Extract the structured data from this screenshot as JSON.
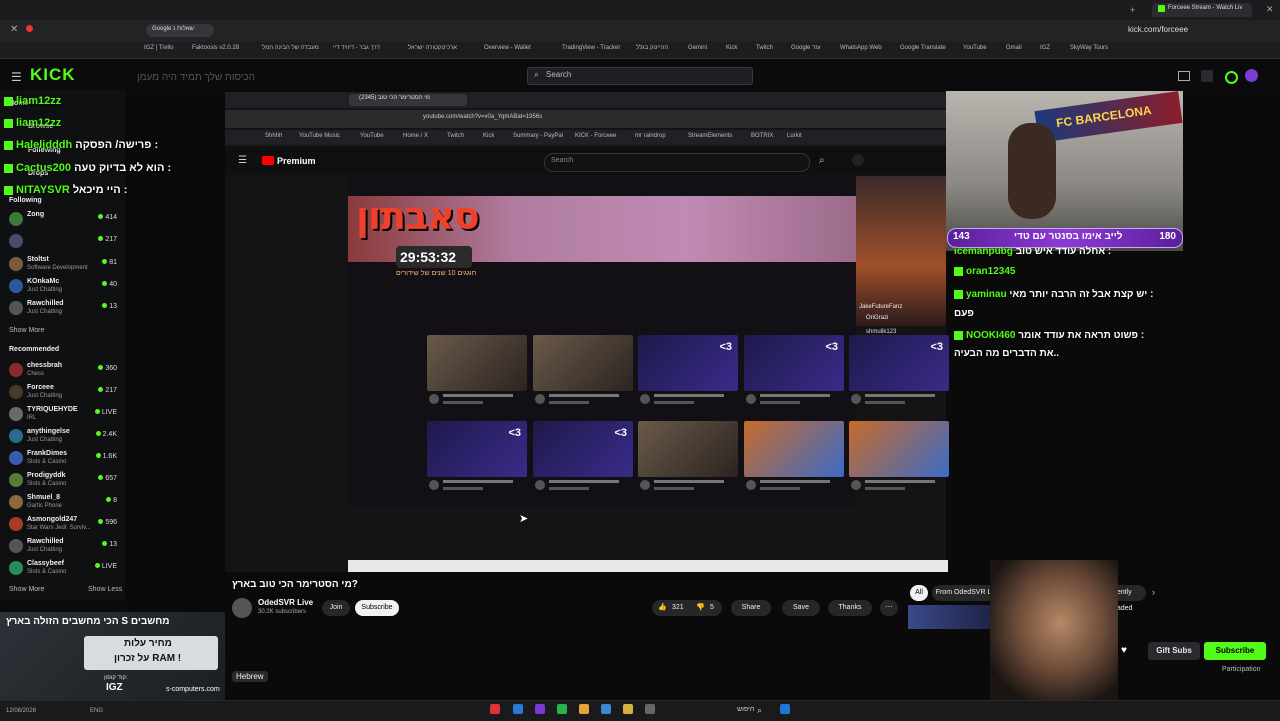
{
  "browser": {
    "tab_title": "Forceee Stream - Watch Liv",
    "url": "kick.com/forceee",
    "inner_tab_title": "Google שאלות נ",
    "bookmarks": [
      "IGZ | Trello",
      "Faktoosis v2.0.28",
      "מעבדה של הבינה המל",
      "דרך גבר - דיוויד דיי",
      "ארכיטקטורה ישראל",
      "Overview - Wallet",
      "TradingView - Tracker",
      "ההייטק בגלל",
      "Gemini",
      "Kick",
      "Twitch",
      "Google עזר",
      "WhatsApp Web",
      "Google Translate",
      "YouTube",
      "Gmail",
      "IGZ",
      "SkyWay Tours"
    ]
  },
  "kick": {
    "logo": "KICK",
    "search_placeholder": "Search",
    "faded_ticker": "הכיסות שלך תמיד היה מעמן",
    "nav": [
      "Home",
      "Browse",
      "Following",
      "Drops"
    ],
    "following_label": "Following",
    "following": [
      {
        "name": "Zong",
        "category": "",
        "count": "414"
      },
      {
        "name": "",
        "category": "",
        "count": "217"
      },
      {
        "name": "Stoltst",
        "category": "Software Development",
        "count": "81"
      },
      {
        "name": "KOnkaMc",
        "category": "Just Chatting",
        "count": "40"
      },
      {
        "name": "Rawchilled",
        "category": "Just Chatting",
        "count": "13"
      }
    ],
    "show_more": "Show More",
    "recommended_label": "Recommended",
    "recommended": [
      {
        "name": "chessbrah",
        "category": "Chess",
        "count": "360"
      },
      {
        "name": "Forceee",
        "category": "Just Chatting",
        "count": "217"
      },
      {
        "name": "TYRIQUEHYDE",
        "category": "IRL",
        "count": "LIVE"
      },
      {
        "name": "anythingelse",
        "category": "Just Chatting",
        "count": "2.4K"
      },
      {
        "name": "FrankDimes",
        "category": "Slots & Casino",
        "count": "1.6K"
      },
      {
        "name": "Prodigyddk",
        "category": "Slots & Casino",
        "count": "657"
      },
      {
        "name": "Shmuel_8",
        "category": "Gartic Phone",
        "count": "8"
      },
      {
        "name": "Asmongold247",
        "category": "Star Wars Jedi: Surviv...",
        "count": "596"
      },
      {
        "name": "Rawchilled",
        "category": "Just Chatting",
        "count": "13"
      },
      {
        "name": "Classybeef",
        "category": "Slots & Casino",
        "count": "LIVE"
      }
    ],
    "show_more_2": "Show More",
    "show_less": "Show Less",
    "gift_subs": "Gift Subs",
    "subscribe": "Subscribe",
    "participation": "Participation"
  },
  "overlay_chat_left": [
    {
      "user": "liam12zz",
      "message": ""
    },
    {
      "user": "liam12zz",
      "message": ""
    },
    {
      "user": "Haleljdddh",
      "message": "פרישה/ הפסקה :"
    },
    {
      "user": "Cactus200",
      "message": "הוא לא בדיוק טעה :"
    },
    {
      "user": "NITAYSVR",
      "message": "היי מיכאל :"
    }
  ],
  "overlay_chat_right": [
    {
      "user": "icemanpubg",
      "message": "אחלה עודד איש טוב :"
    },
    {
      "user": "oran12345",
      "message": ""
    },
    {
      "user": "yaminau",
      "message": "יש קצת אבל זה הרבה יותר מאי :"
    },
    {
      "user": "",
      "message": "פעם"
    },
    {
      "user": "NOOKI460",
      "message": "פשוט תראה את עודד אומר :"
    },
    {
      "user": "",
      "message": "את הדברים מה הבעיה.."
    }
  ],
  "webcam": {
    "flag_text": "FC BARCELONA",
    "bar_left": "143",
    "bar_text": "לייב אימו בסנטר עם טדי",
    "bar_right": "180"
  },
  "youtube": {
    "url": "youtube.com/watch?v=v0a_YqmABat=1956s",
    "tab": "מי הסטרימר הכי טוב (2345)",
    "bookmarks": [
      "Shhhh",
      "YouTube Music",
      "YouTube",
      "Home / X",
      "Twitch",
      "Kick",
      "Summary - PayPal",
      "KICK - Forceee",
      "mr raindrop",
      "StreamElements",
      "BOTRIX",
      "Lurkit"
    ],
    "logo": "Premium",
    "search_placeholder": "Search",
    "inner_banner_title": "סאבתון",
    "timer": "29:53:32",
    "timer_sub": "חוגגים 10 שנים של שידורים",
    "video_title": "מי הסטרימר הכי טוב בארץ?",
    "channel": "OdedSVR Live",
    "subs": "30.2K subscribers",
    "join": "Join",
    "subscribe": "Subscribe",
    "likes": "321",
    "dislikes": "5",
    "share": "Share",
    "save": "Save",
    "thanks": "Thanks",
    "chips": [
      "All",
      "From OdedSVR Live",
      "Recently uploaded"
    ],
    "language": "Hebrew",
    "inner_stream_overlay": [
      "JakeFutureFanz",
      "OriGrazi",
      "shmulik123"
    ]
  },
  "ad": {
    "line1": "הכי מחשבים הזולה בארץ S מחשבים",
    "price1": "מחיר עלות",
    "price2": "על זכרון RAM !",
    "code_label": "קוד קופון:",
    "code": "IGZ",
    "site": "s-computers.com"
  },
  "taskbar": {
    "date": "12/08/2026",
    "lang": "ENG",
    "search": "חיפוש"
  }
}
